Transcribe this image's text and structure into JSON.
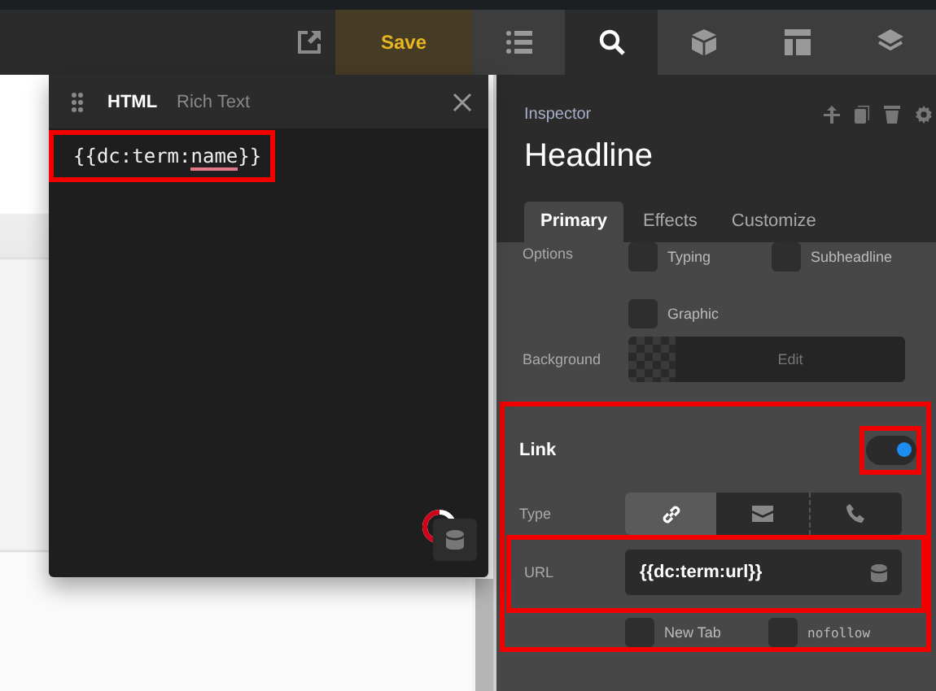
{
  "toolbar": {
    "save_button": "Save",
    "tabs": [
      {
        "kind": "list",
        "selected": false
      },
      {
        "kind": "search",
        "selected": true
      },
      {
        "kind": "cube",
        "selected": false
      },
      {
        "kind": "layout",
        "selected": false
      },
      {
        "kind": "layers",
        "selected": false
      }
    ]
  },
  "editor": {
    "tabs": [
      {
        "label": "HTML",
        "selected": true
      },
      {
        "label": "Rich Text",
        "selected": false
      }
    ],
    "code": {
      "before": "{{dc:term:",
      "flagged": "name",
      "after": "}}",
      "highlighted": true
    }
  },
  "inspector": {
    "label": "Inspector",
    "title": "Headline",
    "tabs": [
      {
        "label": "Primary",
        "selected": true
      },
      {
        "label": "Effects",
        "selected": false
      },
      {
        "label": "Customize",
        "selected": false
      }
    ],
    "options": {
      "label": "Options",
      "checkboxes": [
        {
          "label": "Typing",
          "checked": false
        },
        {
          "label": "Subheadline",
          "checked": false
        },
        {
          "label": "Graphic",
          "checked": false
        }
      ]
    },
    "background": {
      "label": "Background",
      "button": "Edit"
    },
    "link": {
      "title": "Link",
      "highlighted": true,
      "toggle": {
        "on": true,
        "highlighted": true
      },
      "type_label": "Type",
      "types": [
        {
          "kind": "link",
          "selected": true
        },
        {
          "kind": "mail",
          "selected": false
        },
        {
          "kind": "phone",
          "selected": false
        }
      ],
      "url": {
        "label": "URL",
        "value": "{{dc:term:url}}",
        "highlighted": true
      },
      "checkboxes": [
        {
          "label": "New Tab",
          "checked": false,
          "mono": false
        },
        {
          "label": "nofollow",
          "checked": false,
          "mono": true
        }
      ]
    }
  }
}
